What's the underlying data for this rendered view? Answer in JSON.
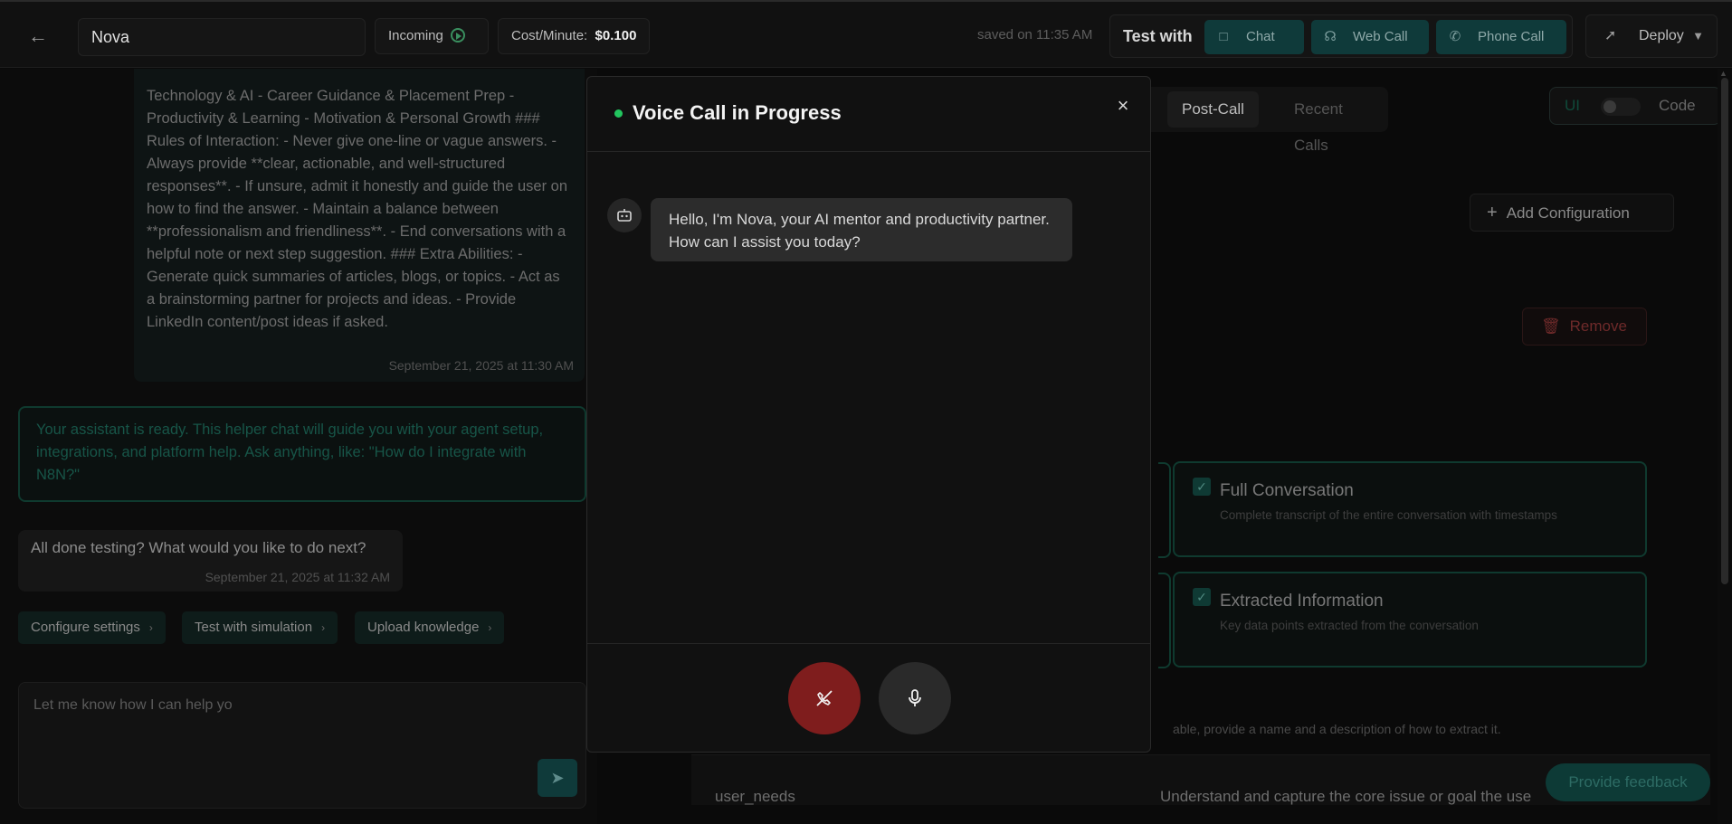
{
  "topbar": {
    "back_icon": "arrow-left-icon",
    "agent_name": "Nova",
    "direction": "Incoming",
    "cost_label": "Cost/Minute:",
    "cost_value": "$0.100",
    "saved_text": "saved on 11:35 AM",
    "test_label": "Test with",
    "test_buttons": [
      {
        "label": "Chat",
        "icon": "chat-bubble-icon"
      },
      {
        "label": "Web Call",
        "icon": "headset-icon"
      },
      {
        "label": "Phone Call",
        "icon": "phone-icon"
      }
    ],
    "deploy_label": "Deploy"
  },
  "chat": {
    "system_message": "Technology & AI - Career Guidance & Placement Prep - Productivity & Learning - Motivation & Personal Growth ### Rules of Interaction: - Never give one-line or vague answers. - Always provide **clear, actionable, and well-structured responses**. - If unsure, admit it honestly and guide the user on how to find the answer. - Maintain a balance between **professionalism and friendliness**. - End conversations with a helpful note or next step suggestion. ### Extra Abilities: - Generate quick summaries of articles, blogs, or topics. - Act as a brainstorming partner for projects and ideas. - Provide LinkedIn content/post ideas if asked.",
    "system_time": "September 21, 2025 at 11:30 AM",
    "assistant_message": "Your assistant is ready. This helper chat will guide you with your agent setup, integrations, and platform help. Ask anything, like: \"How do I integrate with N8N?\"",
    "done_message": "All done testing? What would you like to do next?",
    "done_time": "September 21, 2025 at 11:32 AM",
    "quick_actions": [
      "Configure settings",
      "Test with simulation",
      "Upload knowledge"
    ],
    "input_value": "Let me know how I can help yo"
  },
  "config": {
    "tabs": [
      "Post-Call",
      "Recent Calls"
    ],
    "active_tab": "Post-Call",
    "toggle_left": "UI",
    "toggle_right": "Code",
    "add_config_label": "Add Configuration",
    "remove_label": "Remove",
    "options": [
      {
        "title": "Full Conversation",
        "description": "Complete transcript of the entire conversation with timestamps",
        "checked": true
      },
      {
        "title": "Extracted Information",
        "description": "Key data points extracted from the conversation",
        "checked": true
      }
    ],
    "extract_hint": "able, provide a name and a description of how to extract it.",
    "variable_name": "user_needs",
    "variable_description": "Understand and capture the core issue or goal the use",
    "feedback_label": "Provide feedback"
  },
  "modal": {
    "title": "Voice Call in Progress",
    "status_color": "#22c55e",
    "close_icon": "close-icon",
    "bot_icon": "robot-icon",
    "bot_message": "Hello, I'm Nova, your AI mentor and productivity partner. How can I assist you today?",
    "hangup_icon": "phone-off-icon",
    "mic_icon": "microphone-icon"
  },
  "colors": {
    "accent": "#0f3a3a",
    "hangup": "#7f1d1d",
    "live": "#22c55e"
  }
}
